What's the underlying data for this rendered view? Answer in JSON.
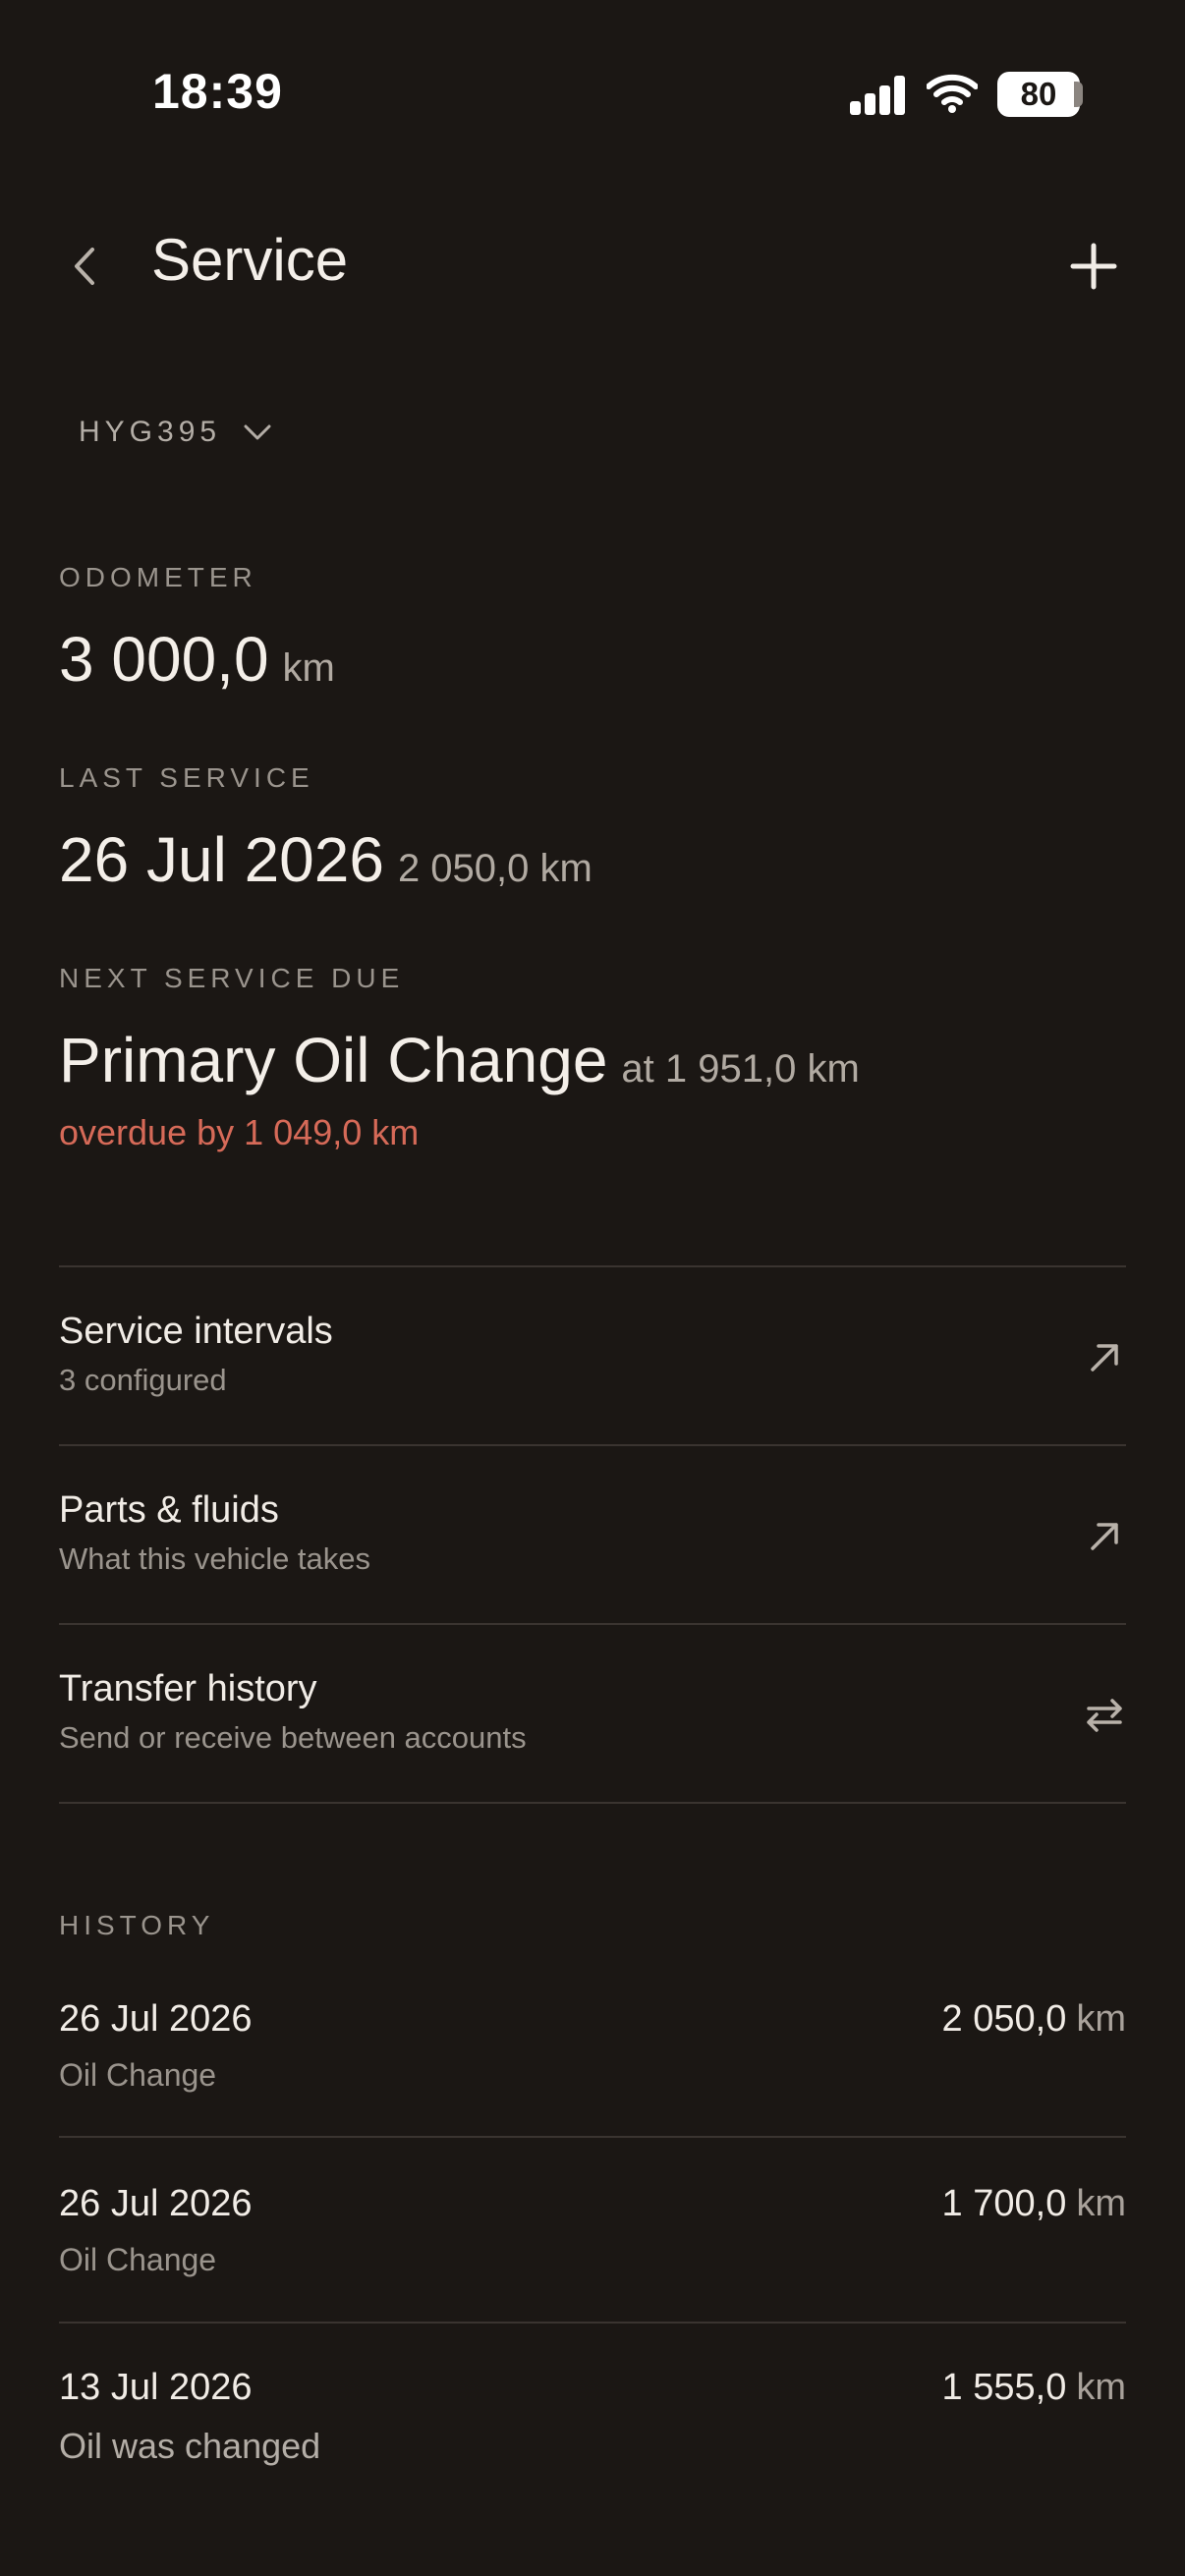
{
  "status_bar": {
    "time": "18:39",
    "battery": "80"
  },
  "header": {
    "title": "Service"
  },
  "vehicle": {
    "plate": "HYG395"
  },
  "odometer": {
    "label": "ODOMETER",
    "value": "3 000,0",
    "unit": "km"
  },
  "last_service": {
    "label": "LAST SERVICE",
    "date": "26 Jul 2026",
    "km": "2 050,0 km"
  },
  "next_service": {
    "label": "NEXT SERVICE DUE",
    "name": "Primary Oil Change",
    "at": "at 1 951,0 km",
    "overdue": "overdue by 1 049,0 km"
  },
  "links": [
    {
      "title": "Service intervals",
      "subtitle": "3 configured",
      "icon": "arrow-up-right-icon"
    },
    {
      "title": "Parts & fluids",
      "subtitle": "What this vehicle takes",
      "icon": "arrow-up-right-icon"
    },
    {
      "title": "Transfer history",
      "subtitle": "Send or receive between accounts",
      "icon": "transfer-arrows-icon"
    }
  ],
  "history": {
    "label": "HISTORY",
    "items": [
      {
        "date": "26 Jul 2026",
        "note": "Oil Change",
        "km": "2 050,0",
        "unit": "km"
      },
      {
        "date": "26 Jul 2026",
        "note": "Oil Change",
        "km": "1 700,0",
        "unit": "km"
      },
      {
        "date": "13 Jul 2026",
        "note": "Oil was changed",
        "km": "1 555,0",
        "unit": "km"
      }
    ]
  },
  "colors": {
    "background": "#1b1714",
    "text": "#f1ece6",
    "muted": "#9a948d",
    "overdue": "#d66a58",
    "divider": "#3a3430"
  }
}
